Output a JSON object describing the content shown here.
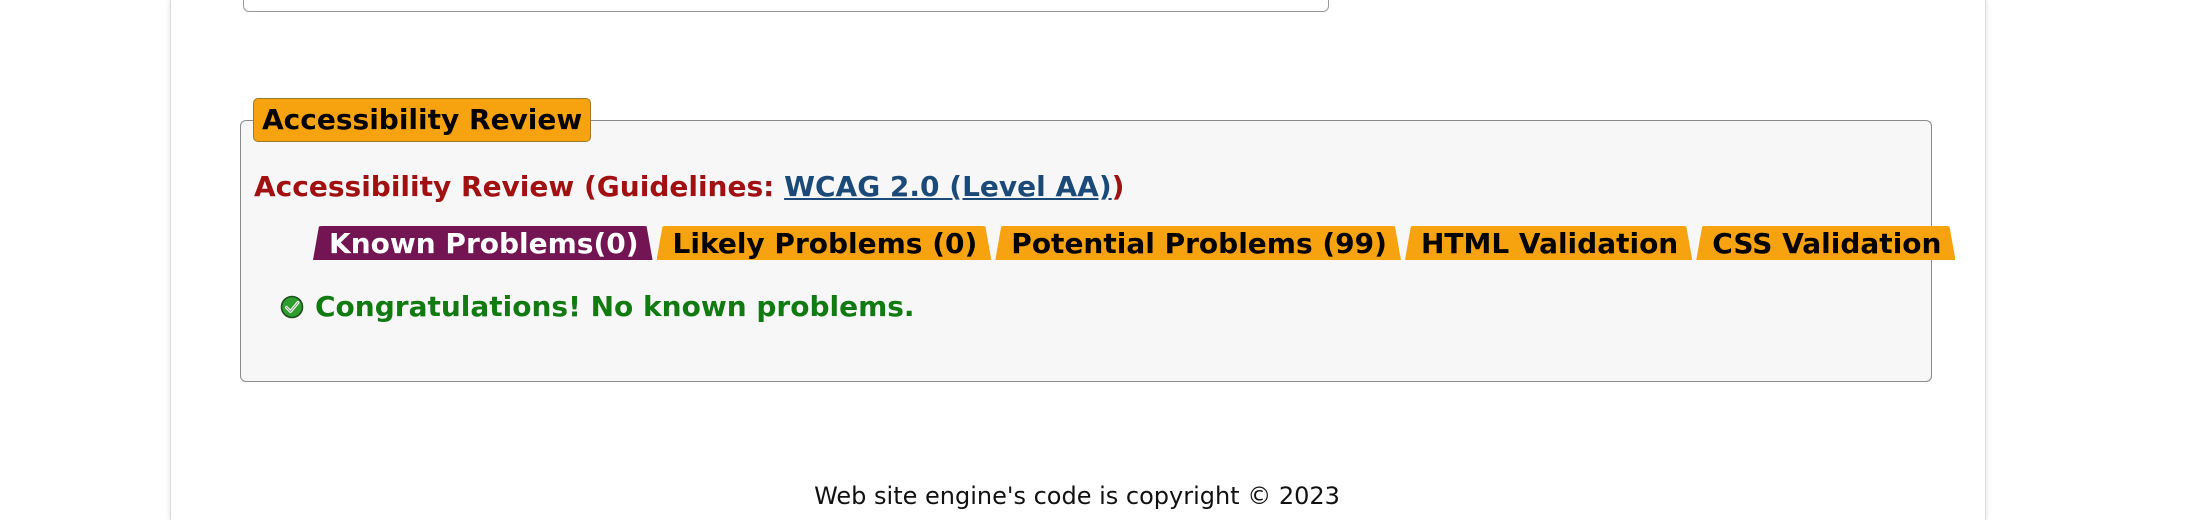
{
  "review": {
    "legend": "Accessibility Review",
    "heading_prefix": "Accessibility Review (Guidelines: ",
    "guideline_link": "WCAG 2.0 (Level AA)",
    "heading_suffix": ")"
  },
  "tabs": [
    {
      "label": "Known Problems(0)",
      "active": true
    },
    {
      "label": "Likely Problems (0)",
      "active": false
    },
    {
      "label": "Potential Problems (99)",
      "active": false
    },
    {
      "label": "HTML Validation",
      "active": false
    },
    {
      "label": "CSS Validation",
      "active": false
    }
  ],
  "result": {
    "icon": "check-icon",
    "message": "Congratulations! No known problems."
  },
  "footer": {
    "text": "Web site engine's code is copyright © 2023"
  },
  "colors": {
    "legend_bg": "#f7a30f",
    "tab_bg": "#f7a30f",
    "tab_active_bg": "#731552",
    "heading": "#a11111",
    "link": "#1b4a79",
    "success": "#117a11"
  }
}
